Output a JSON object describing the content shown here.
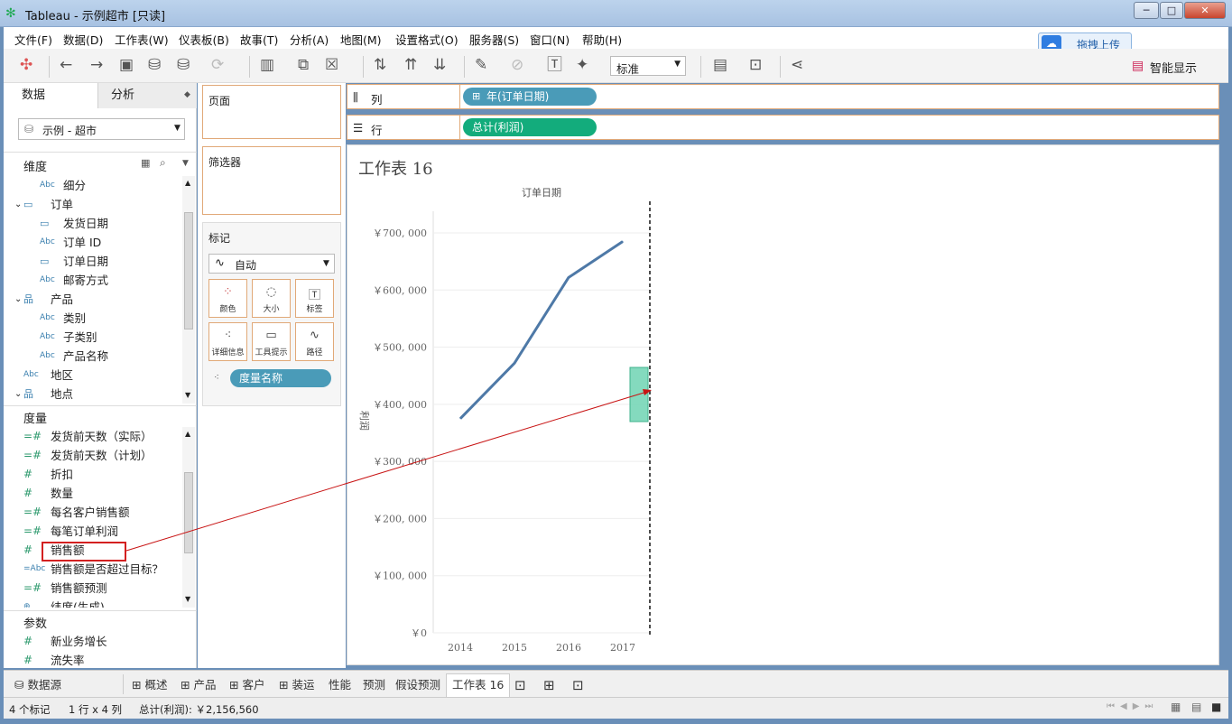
{
  "window": {
    "title": "Tableau - 示例超市 [只读]",
    "min": "─",
    "max": "□",
    "close": "✕"
  },
  "menu": [
    "文件(F)",
    "数据(D)",
    "工作表(W)",
    "仪表板(B)",
    "故事(T)",
    "分析(A)",
    "地图(M)",
    "设置格式(O)",
    "服务器(S)",
    "窗口(N)",
    "帮助(H)"
  ],
  "upload": {
    "label": "拖拽上传"
  },
  "toolbar": {
    "view_select": "标准",
    "show_me": "智能显示"
  },
  "left": {
    "tab_data": "数据",
    "tab_analysis": "分析",
    "datasource": "示例 - 超市",
    "dimensions_title": "维度",
    "dimensions": [
      {
        "type": "Abc",
        "label": "细分",
        "indent": 2
      },
      {
        "type": "folder",
        "label": "订单",
        "indent": 1,
        "expanded": true
      },
      {
        "type": "date",
        "label": "发货日期",
        "indent": 2
      },
      {
        "type": "Abc",
        "label": "订单 ID",
        "indent": 2
      },
      {
        "type": "date",
        "label": "订单日期",
        "indent": 2
      },
      {
        "type": "Abc",
        "label": "邮寄方式",
        "indent": 2
      },
      {
        "type": "hier",
        "label": "产品",
        "indent": 1,
        "expanded": true
      },
      {
        "type": "Abc",
        "label": "类别",
        "indent": 2
      },
      {
        "type": "Abc",
        "label": "子类别",
        "indent": 2
      },
      {
        "type": "Abc",
        "label": "产品名称",
        "indent": 2
      },
      {
        "type": "Abc",
        "label": "地区",
        "indent": 1
      },
      {
        "type": "hier",
        "label": "地点",
        "indent": 1,
        "expanded": true
      }
    ],
    "measures_title": "度量",
    "measures": [
      {
        "type": "=#",
        "label": "发货前天数（实际）"
      },
      {
        "type": "=#",
        "label": "发货前天数（计划）"
      },
      {
        "type": "#",
        "label": "折扣"
      },
      {
        "type": "#",
        "label": "数量"
      },
      {
        "type": "=#",
        "label": "每名客户销售额"
      },
      {
        "type": "=#",
        "label": "每笔订单利润"
      },
      {
        "type": "#",
        "label": "销售额"
      },
      {
        "type": "=Abc",
        "label": "销售额是否超过目标？"
      },
      {
        "type": "=#",
        "label": "销售额预测"
      },
      {
        "type": "geo",
        "label": "纬度(生成)"
      }
    ],
    "params_title": "参数",
    "params": [
      {
        "type": "#",
        "label": "新业务增长"
      },
      {
        "type": "#",
        "label": "流失率"
      }
    ]
  },
  "mid": {
    "pages": "页面",
    "filters": "筛选器",
    "marks": "标记",
    "mark_type": "自动",
    "mark_buttons": [
      "颜色",
      "大小",
      "标签",
      "详细信息",
      "工具提示",
      "路径"
    ],
    "measure_names_pill": "度量名称"
  },
  "shelves": {
    "columns_label": "列",
    "columns_pill": "年(订单日期)",
    "rows_label": "行",
    "rows_pill": "总计(利润)"
  },
  "sheet_title": "工作表 16",
  "chart_data": {
    "type": "line",
    "title": "订单日期",
    "ylabel": "利润",
    "categories": [
      "2014",
      "2015",
      "2016",
      "2017"
    ],
    "values": [
      375000,
      472000,
      622000,
      685000
    ],
    "yticks": [
      "￥700, 000",
      "￥600, 000",
      "￥500, 000",
      "￥400, 000",
      "￥300, 000",
      "￥200, 000",
      "￥100, 000",
      "￥0"
    ],
    "ytick_values": [
      700000,
      600000,
      500000,
      400000,
      300000,
      200000,
      100000,
      0
    ],
    "ylim": [
      0,
      730000
    ],
    "color": "#4e79a7"
  },
  "tabs": [
    "数据源",
    "概述",
    "产品",
    "客户",
    "装运",
    "性能",
    "预测",
    "假设预测",
    "工作表 16"
  ],
  "status": {
    "marks": "4 个标记",
    "rows_cols": "1 行 x 4 列",
    "sum": "总计(利润): ￥2,156,560"
  }
}
